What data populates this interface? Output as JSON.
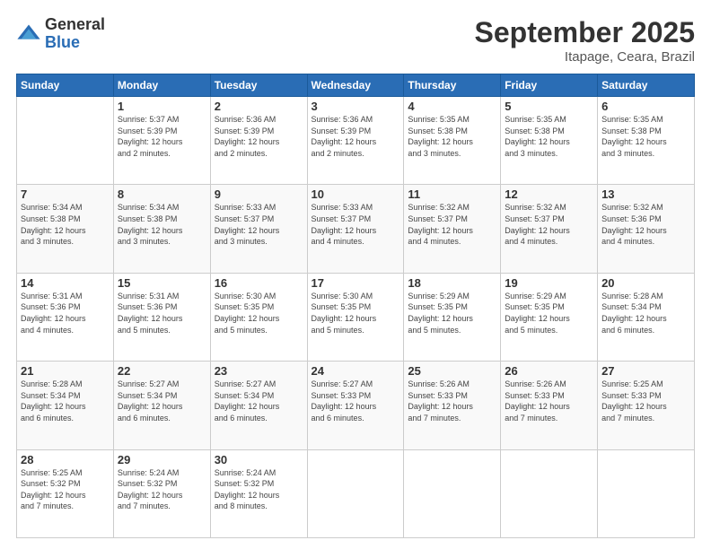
{
  "logo": {
    "general": "General",
    "blue": "Blue"
  },
  "title": "September 2025",
  "subtitle": "Itapage, Ceara, Brazil",
  "weekdays": [
    "Sunday",
    "Monday",
    "Tuesday",
    "Wednesday",
    "Thursday",
    "Friday",
    "Saturday"
  ],
  "weeks": [
    [
      {
        "day": "",
        "info": ""
      },
      {
        "day": "1",
        "info": "Sunrise: 5:37 AM\nSunset: 5:39 PM\nDaylight: 12 hours\nand 2 minutes."
      },
      {
        "day": "2",
        "info": "Sunrise: 5:36 AM\nSunset: 5:39 PM\nDaylight: 12 hours\nand 2 minutes."
      },
      {
        "day": "3",
        "info": "Sunrise: 5:36 AM\nSunset: 5:39 PM\nDaylight: 12 hours\nand 2 minutes."
      },
      {
        "day": "4",
        "info": "Sunrise: 5:35 AM\nSunset: 5:38 PM\nDaylight: 12 hours\nand 3 minutes."
      },
      {
        "day": "5",
        "info": "Sunrise: 5:35 AM\nSunset: 5:38 PM\nDaylight: 12 hours\nand 3 minutes."
      },
      {
        "day": "6",
        "info": "Sunrise: 5:35 AM\nSunset: 5:38 PM\nDaylight: 12 hours\nand 3 minutes."
      }
    ],
    [
      {
        "day": "7",
        "info": "Sunrise: 5:34 AM\nSunset: 5:38 PM\nDaylight: 12 hours\nand 3 minutes."
      },
      {
        "day": "8",
        "info": "Sunrise: 5:34 AM\nSunset: 5:38 PM\nDaylight: 12 hours\nand 3 minutes."
      },
      {
        "day": "9",
        "info": "Sunrise: 5:33 AM\nSunset: 5:37 PM\nDaylight: 12 hours\nand 3 minutes."
      },
      {
        "day": "10",
        "info": "Sunrise: 5:33 AM\nSunset: 5:37 PM\nDaylight: 12 hours\nand 4 minutes."
      },
      {
        "day": "11",
        "info": "Sunrise: 5:32 AM\nSunset: 5:37 PM\nDaylight: 12 hours\nand 4 minutes."
      },
      {
        "day": "12",
        "info": "Sunrise: 5:32 AM\nSunset: 5:37 PM\nDaylight: 12 hours\nand 4 minutes."
      },
      {
        "day": "13",
        "info": "Sunrise: 5:32 AM\nSunset: 5:36 PM\nDaylight: 12 hours\nand 4 minutes."
      }
    ],
    [
      {
        "day": "14",
        "info": "Sunrise: 5:31 AM\nSunset: 5:36 PM\nDaylight: 12 hours\nand 4 minutes."
      },
      {
        "day": "15",
        "info": "Sunrise: 5:31 AM\nSunset: 5:36 PM\nDaylight: 12 hours\nand 5 minutes."
      },
      {
        "day": "16",
        "info": "Sunrise: 5:30 AM\nSunset: 5:35 PM\nDaylight: 12 hours\nand 5 minutes."
      },
      {
        "day": "17",
        "info": "Sunrise: 5:30 AM\nSunset: 5:35 PM\nDaylight: 12 hours\nand 5 minutes."
      },
      {
        "day": "18",
        "info": "Sunrise: 5:29 AM\nSunset: 5:35 PM\nDaylight: 12 hours\nand 5 minutes."
      },
      {
        "day": "19",
        "info": "Sunrise: 5:29 AM\nSunset: 5:35 PM\nDaylight: 12 hours\nand 5 minutes."
      },
      {
        "day": "20",
        "info": "Sunrise: 5:28 AM\nSunset: 5:34 PM\nDaylight: 12 hours\nand 6 minutes."
      }
    ],
    [
      {
        "day": "21",
        "info": "Sunrise: 5:28 AM\nSunset: 5:34 PM\nDaylight: 12 hours\nand 6 minutes."
      },
      {
        "day": "22",
        "info": "Sunrise: 5:27 AM\nSunset: 5:34 PM\nDaylight: 12 hours\nand 6 minutes."
      },
      {
        "day": "23",
        "info": "Sunrise: 5:27 AM\nSunset: 5:34 PM\nDaylight: 12 hours\nand 6 minutes."
      },
      {
        "day": "24",
        "info": "Sunrise: 5:27 AM\nSunset: 5:33 PM\nDaylight: 12 hours\nand 6 minutes."
      },
      {
        "day": "25",
        "info": "Sunrise: 5:26 AM\nSunset: 5:33 PM\nDaylight: 12 hours\nand 7 minutes."
      },
      {
        "day": "26",
        "info": "Sunrise: 5:26 AM\nSunset: 5:33 PM\nDaylight: 12 hours\nand 7 minutes."
      },
      {
        "day": "27",
        "info": "Sunrise: 5:25 AM\nSunset: 5:33 PM\nDaylight: 12 hours\nand 7 minutes."
      }
    ],
    [
      {
        "day": "28",
        "info": "Sunrise: 5:25 AM\nSunset: 5:32 PM\nDaylight: 12 hours\nand 7 minutes."
      },
      {
        "day": "29",
        "info": "Sunrise: 5:24 AM\nSunset: 5:32 PM\nDaylight: 12 hours\nand 7 minutes."
      },
      {
        "day": "30",
        "info": "Sunrise: 5:24 AM\nSunset: 5:32 PM\nDaylight: 12 hours\nand 8 minutes."
      },
      {
        "day": "",
        "info": ""
      },
      {
        "day": "",
        "info": ""
      },
      {
        "day": "",
        "info": ""
      },
      {
        "day": "",
        "info": ""
      }
    ]
  ]
}
